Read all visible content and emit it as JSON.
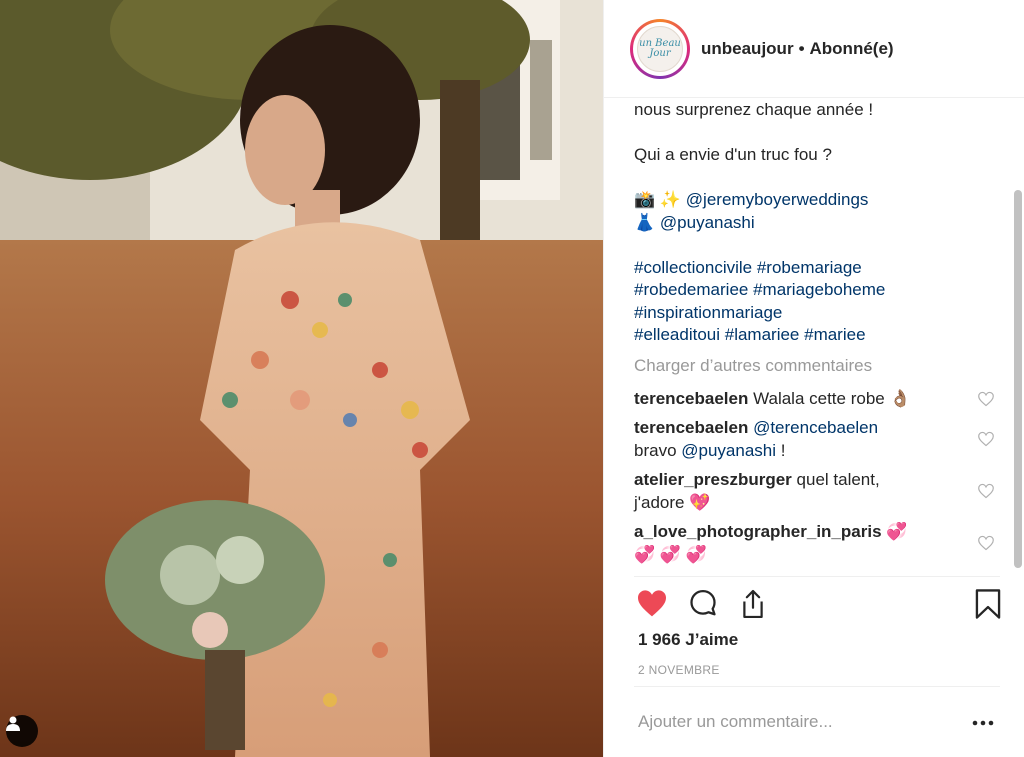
{
  "header": {
    "avatar_text": "un Beau Jour",
    "username": "unbeaujour",
    "separator": "•",
    "follow_status": "Abonné(e)"
  },
  "caption": {
    "lines": [
      "nous surprenez chaque année !",
      "",
      "Qui a envie d'un truc fou ?",
      ""
    ],
    "credit_1_emoji": "📸 ✨",
    "credit_1_handle": "@jeremyboyerweddings",
    "credit_2_emoji": "👗",
    "credit_2_handle": "@puyanashi",
    "hashtags": [
      "#collectioncivile #robemariage",
      "#robedemariee #mariageboheme",
      "#inspirationmariage",
      "#elleaditoui #lamariee #mariee"
    ]
  },
  "load_more": "Charger d’autres commentaires",
  "comments": [
    {
      "user": "terencebaelen",
      "text": "Walala cette robe 👌🏽"
    },
    {
      "user": "terencebaelen",
      "mention": "@terencebaelen",
      "text_prefix": "bravo ",
      "mention2": "@puyanashi",
      "text_suffix": " !"
    },
    {
      "user": "atelier_preszburger",
      "text": "quel talent,",
      "text2": "j'adore 💖"
    },
    {
      "user": "a_love_photographer_in_paris",
      "text": "💞",
      "text2": "💞 💞 💞"
    }
  ],
  "likes": "1 966 J’aime",
  "date": "2 NOVEMBRE",
  "add_comment_placeholder": "Ajouter un commentaire...",
  "more_label": "•••",
  "colors": {
    "like_red": "#ed4956",
    "link_blue": "#003569",
    "muted_gray": "#999999",
    "text": "#262626"
  },
  "icons": {
    "tag": "user-tag-icon",
    "like": "heart-filled-icon",
    "comment": "comment-bubble-icon",
    "share": "share-icon",
    "save": "bookmark-icon",
    "comment_like": "heart-outline-icon"
  }
}
